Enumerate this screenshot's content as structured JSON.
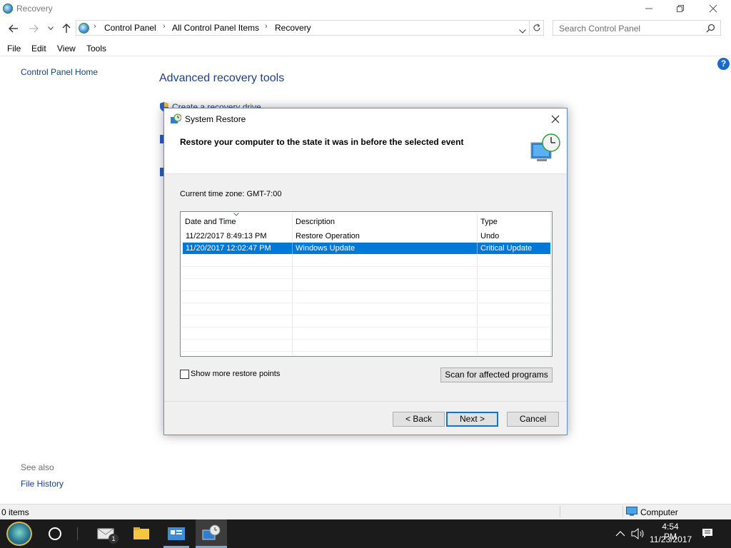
{
  "window": {
    "title": "Recovery"
  },
  "address": {
    "breadcrumb": [
      "Control Panel",
      "All Control Panel Items",
      "Recovery"
    ],
    "search_placeholder": "Search Control Panel"
  },
  "menu": [
    "File",
    "Edit",
    "View",
    "Tools"
  ],
  "sidebar": {
    "home_link": "Control Panel Home",
    "see_also_label": "See also",
    "see_also_links": [
      "File History"
    ]
  },
  "main": {
    "heading": "Advanced recovery tools",
    "links": [
      "Create a recovery drive"
    ]
  },
  "status_bar": {
    "items_text": "0 items",
    "zone_text": "Computer"
  },
  "taskbar": {
    "time": "4:54 PM",
    "date": "11/23/2017",
    "mail_badge": "1"
  },
  "dialog": {
    "title": "System Restore",
    "header_text": "Restore your computer to the state it was in before the selected event",
    "timezone_label": "Current time zone: GMT-7:00",
    "columns": [
      "Date and Time",
      "Description",
      "Type"
    ],
    "rows": [
      {
        "date": "11/22/2017 8:49:13 PM",
        "description": "Restore Operation",
        "type": "Undo",
        "selected": false
      },
      {
        "date": "11/20/2017 12:02:47 PM",
        "description": "Windows Update",
        "type": "Critical Update",
        "selected": true
      }
    ],
    "show_more_label": "Show more restore points",
    "show_more_checked": false,
    "scan_button": "Scan for affected programs",
    "back_button": "< Back",
    "next_button": "Next >",
    "cancel_button": "Cancel"
  },
  "colors": {
    "accent": "#0078d7",
    "link": "#1a3e87",
    "heading": "#1e3f85",
    "taskbar": "#1b1b1b"
  }
}
